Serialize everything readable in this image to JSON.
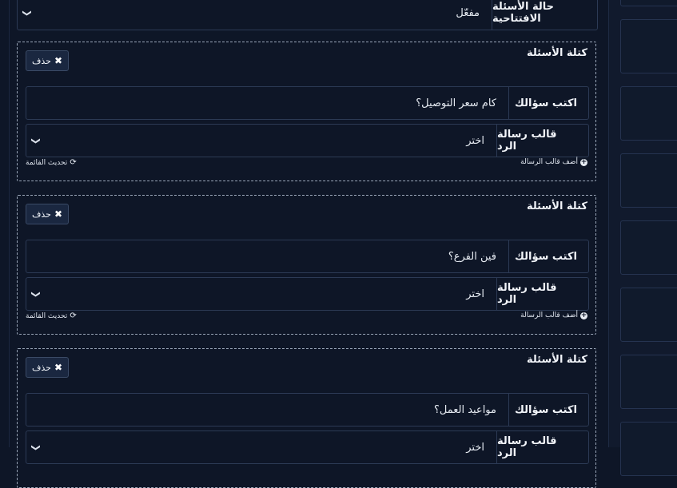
{
  "opening_questions": {
    "label": "حالة الأسئلة الافتتاحية",
    "value": "مفعّل"
  },
  "blocks": [
    {
      "title": "كتلة الأسئلة",
      "delete_label": "حذف",
      "question_label": "اكتب سؤالك",
      "question_value": "كام سعر التوصيل؟",
      "template_label": "قالب رسالة الرد",
      "template_value": "اختر",
      "add_template_label": "أضف قالب الرسالة",
      "refresh_label": "تحديث القائمة"
    },
    {
      "title": "كتلة الأسئلة",
      "delete_label": "حذف",
      "question_label": "اكتب سؤالك",
      "question_value": "فين الفرع؟",
      "template_label": "قالب رسالة الرد",
      "template_value": "اختر",
      "add_template_label": "أضف قالب الرسالة",
      "refresh_label": "تحديث القائمة"
    },
    {
      "title": "كتلة الأسئلة",
      "delete_label": "حذف",
      "question_label": "اكتب سؤالك",
      "question_value": "مواعيد العمل؟",
      "template_label": "قالب رسالة الرد",
      "template_value": "اختر"
    }
  ],
  "icons": {
    "delete": "close-icon",
    "dropdown": "chevron-down-icon",
    "add": "plus-circle-icon",
    "refresh": "refresh-icon"
  },
  "colors": {
    "background": "#0e1627",
    "panel_border": "#2c3a55",
    "dashed_border": "#9aa6b8",
    "text": "#e6ebf2"
  }
}
